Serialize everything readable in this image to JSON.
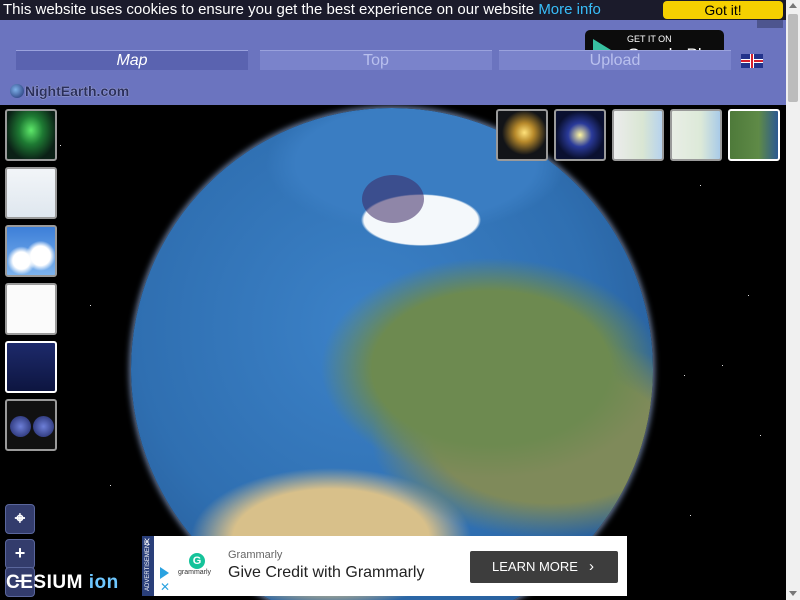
{
  "cookie": {
    "text": "This website uses cookies to ensure you get the best experience on our website",
    "more_info": "More info",
    "accept_label": "Got it!"
  },
  "header": {
    "google_play": {
      "line1": "GET IT ON",
      "line2": "Google Play"
    },
    "tabs": [
      {
        "label": "Map",
        "active": true
      },
      {
        "label": "Top",
        "active": false
      },
      {
        "label": "Upload",
        "active": false
      }
    ],
    "language_flag": "uk-flag-icon",
    "logo": "NightEarth.com"
  },
  "layers_left": [
    "aurora",
    "flat-world-map",
    "clouds",
    "blank-map",
    "night-world-map",
    "two-globes"
  ],
  "layers_top": [
    "city-lights",
    "satellite-night",
    "street-map",
    "terrain-map",
    "satellite"
  ],
  "controls": {
    "locate_label": "⌖",
    "zoom_in_label": "+",
    "zoom_out_label": "−"
  },
  "cesium": {
    "text": "CESIUM",
    "ion": "ion"
  },
  "ad": {
    "tag": "ADVERTISEMENT",
    "close": "X",
    "logo_letter": "G",
    "logo_text": "grammarly",
    "brand": "Grammarly",
    "headline": "Give Credit with Grammarly",
    "cta": "LEARN MORE",
    "cta_icon": "›"
  }
}
